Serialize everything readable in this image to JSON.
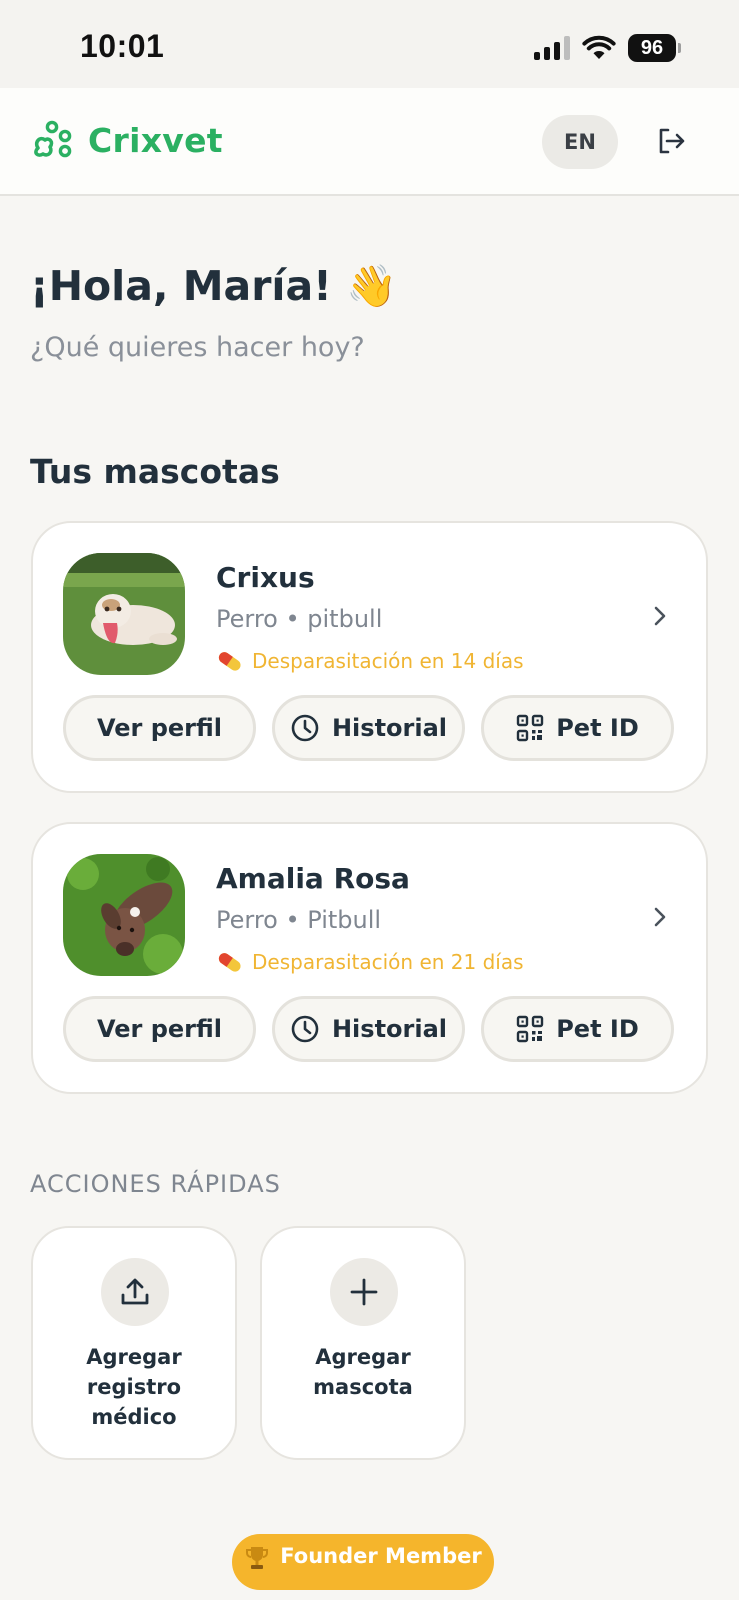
{
  "status_bar": {
    "time": "10:01",
    "battery": "96"
  },
  "header": {
    "brand": "Crixvet",
    "language": "EN"
  },
  "greeting": {
    "title": "¡Hola, María! 👋",
    "subtitle": "¿Qué quieres hacer hoy?"
  },
  "pets_section": {
    "title": "Tus mascotas"
  },
  "pets": [
    {
      "name": "Crixus",
      "meta": "Perro • pitbull",
      "reminder": "Desparasitación en 14 días",
      "actions": {
        "profile": "Ver perfil",
        "history": "Historial",
        "pet_id": "Pet ID"
      }
    },
    {
      "name": "Amalia Rosa",
      "meta": "Perro • Pitbull",
      "reminder": "Desparasitación en 21 días",
      "actions": {
        "profile": "Ver perfil",
        "history": "Historial",
        "pet_id": "Pet ID"
      }
    }
  ],
  "quick_actions": {
    "title": "ACCIONES RÁPIDAS",
    "items": [
      {
        "label": "Agregar\nregistro\nmédico",
        "icon": "upload-icon"
      },
      {
        "label": "Agregar\nmascota",
        "icon": "plus-icon"
      }
    ]
  },
  "badge": {
    "label": "Founder Member",
    "icon": "trophy-icon"
  },
  "colors": {
    "brand": "#2bb062",
    "reminder": "#f0b533",
    "badge": "#f5b52c"
  }
}
